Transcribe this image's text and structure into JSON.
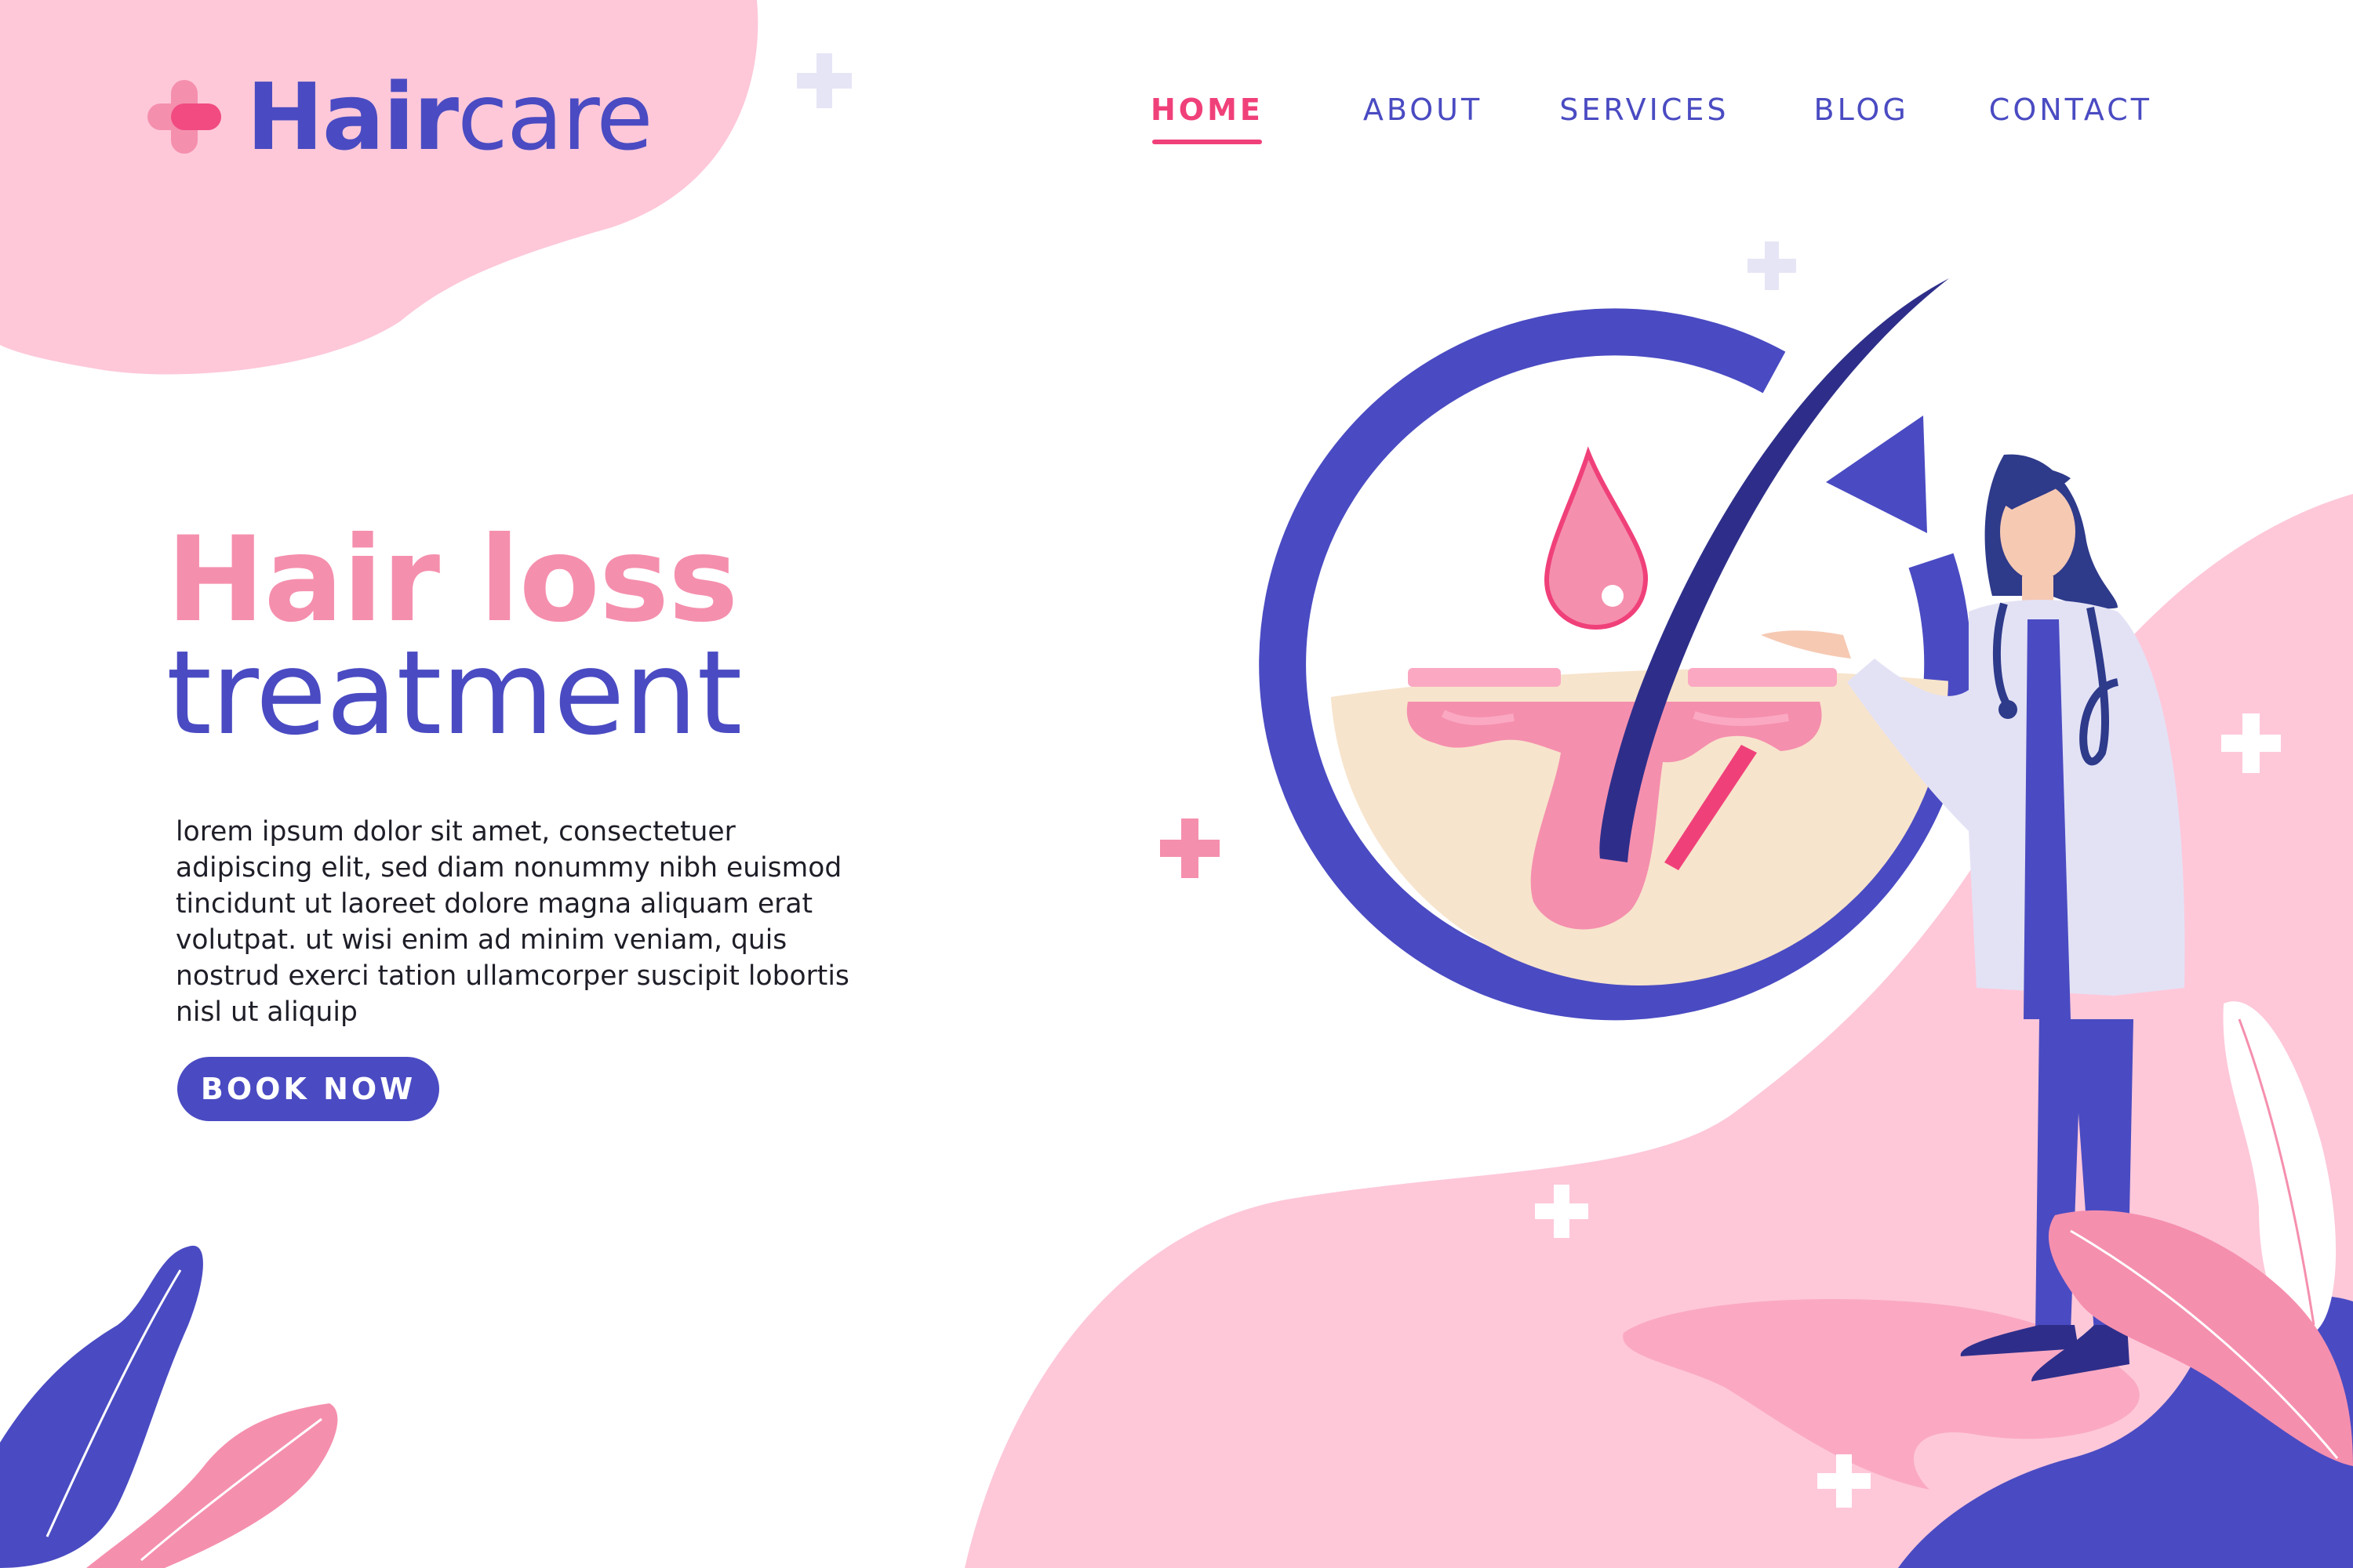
{
  "colors": {
    "brand": "#4a4bc2",
    "accent": "#f0407a",
    "pink": "#f58fae",
    "blob_pink": "#fec8d9",
    "skin": "#f7e4cc"
  },
  "logo": {
    "icon": "plus-cross-icon",
    "part_bold": "Hair",
    "part_regular": "care"
  },
  "nav": {
    "items": [
      {
        "label": "HOME",
        "active": true
      },
      {
        "label": "ABOUT",
        "active": false
      },
      {
        "label": "SERVICES",
        "active": false
      },
      {
        "label": "BLOG",
        "active": false
      },
      {
        "label": "CONTACT",
        "active": false
      }
    ]
  },
  "hero": {
    "title_line1": "Hair loss",
    "title_line2": "treatment",
    "description": "lorem ipsum dolor sit amet, consectetuer adipiscing elit, sed diam nonummy nibh euismod tincidunt ut laoreet dolore magna aliquam erat volutpat. ut wisi enim ad minim veniam, quis nostrud exerci tation ullamcorper suscipit lobortis nisl ut aliquip",
    "cta_label": "BOOK NOW"
  },
  "illustration": {
    "main": "hair-follicle-regrowth-illustration",
    "figure": "doctor-with-stethoscope-illustration",
    "decor": [
      "leaf-icon",
      "plus-sparkle-icon"
    ]
  }
}
